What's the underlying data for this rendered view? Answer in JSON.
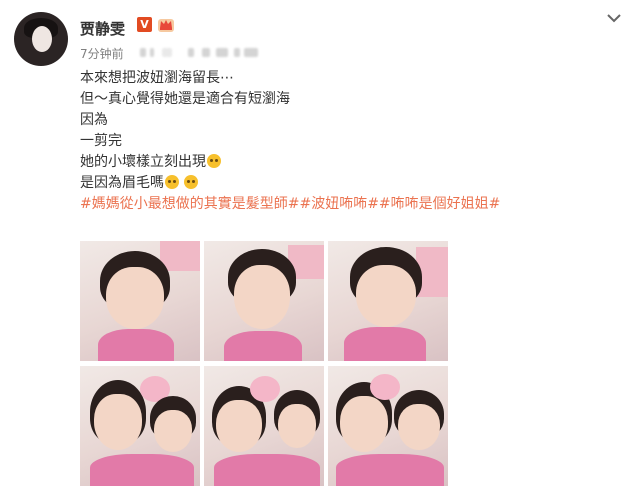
{
  "user": {
    "name": "贾静雯",
    "verified_badge": "V",
    "timestamp": "7分钟前"
  },
  "post": {
    "lines": [
      "本來想把波妞瀏海留長⋯",
      "但～真心覺得她還是適合有短瀏海",
      "因為",
      "一剪完",
      "她的小壞樣立刻出現",
      "是因為眉毛嗎"
    ],
    "hashtags": "#媽媽從小最想做的其實是髮型師##波妞咘咘##咘咘是個好姐姐#"
  },
  "icons": {
    "more": "chevron-down-icon",
    "emoji_a": "smirk-emoji-icon",
    "emoji_b": "thinking-emoji-icon",
    "emoji_c": "smirk-emoji-icon"
  },
  "colors": {
    "hashtag": "#eb7350",
    "verified": "#e24b22",
    "meta": "#808080"
  }
}
